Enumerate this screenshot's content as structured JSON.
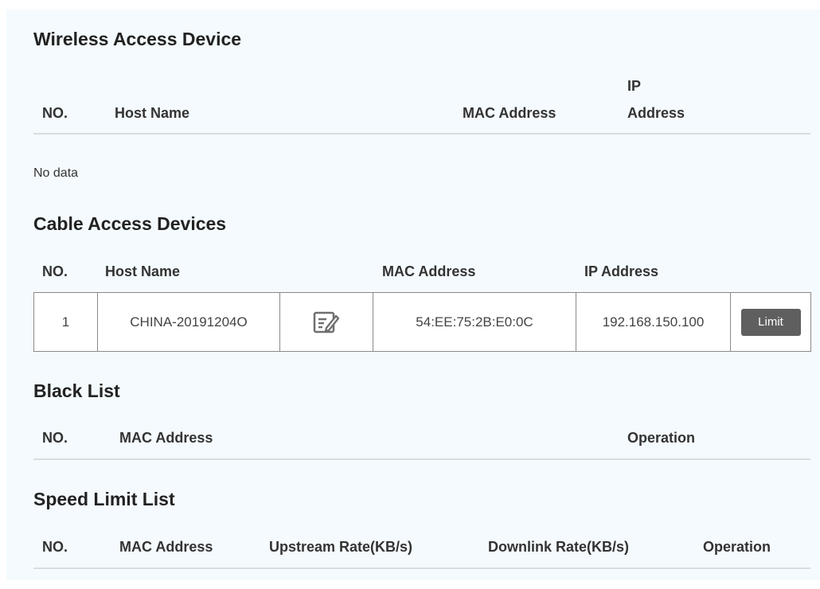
{
  "wireless": {
    "title": "Wireless Access Device",
    "headers": {
      "no": "NO.",
      "host_name": "Host Name",
      "mac": "MAC Address",
      "ip_line1": "IP",
      "ip_line2": "Address"
    },
    "empty_text": "No data"
  },
  "cable": {
    "title": "Cable Access Devices",
    "headers": {
      "no": "NO.",
      "host_name": "Host Name",
      "mac": "MAC Address",
      "ip": "IP Address"
    },
    "rows": [
      {
        "no": "1",
        "host_name": "CHINA-20191204O",
        "mac": "54:EE:75:2B:E0:0C",
        "ip": "192.168.150.100",
        "limit_label": "Limit",
        "edit_icon": "edit-icon"
      }
    ]
  },
  "blacklist": {
    "title": "Black List",
    "headers": {
      "no": "NO.",
      "mac": "MAC Address",
      "operation": "Operation"
    }
  },
  "speedlimit": {
    "title": "Speed Limit List",
    "headers": {
      "no": "NO.",
      "mac": "MAC Address",
      "upstream": "Upstream Rate(KB/s)",
      "downlink": "Downlink Rate(KB/s)",
      "operation": "Operation"
    }
  }
}
